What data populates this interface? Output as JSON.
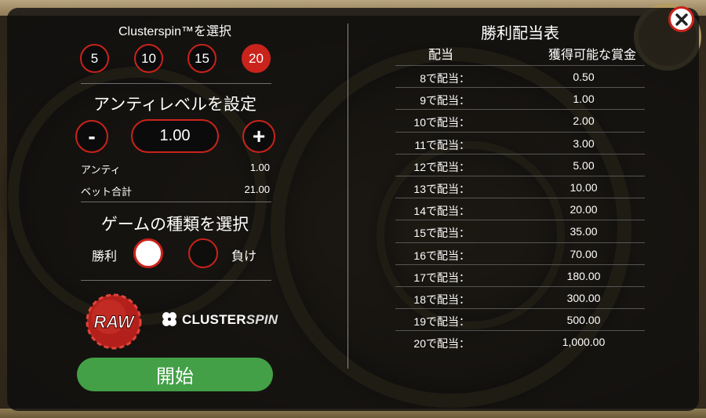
{
  "left": {
    "cluster_title": "Clusterspin™を選択",
    "cluster_options": [
      "5",
      "10",
      "15",
      "20"
    ],
    "cluster_selected": "20",
    "ante_title": "アンティレベルを設定",
    "minus_label": "-",
    "plus_label": "+",
    "ante_value": "1.00",
    "ante_label": "アンティ",
    "ante_amount": "1.00",
    "total_bet_label": "ベット合計",
    "total_bet_amount": "21.00",
    "game_type_title": "ゲームの種類を選択",
    "win_label": "勝利",
    "lose_label": "負け",
    "win_selected": true,
    "raw_logo_text": "RAW",
    "cs_logo_bold": "CLUSTER",
    "cs_logo_italic": "SPIN",
    "start_label": "開始"
  },
  "paytable": {
    "title": "勝利配当表",
    "col_payout": "配当",
    "col_prize": "獲得可能な賞金",
    "rows": [
      {
        "label": "8で配当：",
        "value": "0.50"
      },
      {
        "label": "9で配当：",
        "value": "1.00"
      },
      {
        "label": "10で配当：",
        "value": "2.00"
      },
      {
        "label": "11で配当：",
        "value": "3.00"
      },
      {
        "label": "12で配当：",
        "value": "5.00"
      },
      {
        "label": "13で配当：",
        "value": "10.00"
      },
      {
        "label": "14で配当：",
        "value": "20.00"
      },
      {
        "label": "15で配当：",
        "value": "35.00"
      },
      {
        "label": "16で配当：",
        "value": "70.00"
      },
      {
        "label": "17で配当：",
        "value": "180.00"
      },
      {
        "label": "18で配当：",
        "value": "300.00"
      },
      {
        "label": "19で配当：",
        "value": "500.00"
      },
      {
        "label": "20で配当：",
        "value": "1,000.00"
      }
    ]
  },
  "icons": {
    "close": "close-icon",
    "raw_logo": "raw-logo",
    "clover": "clover-icon"
  },
  "colors": {
    "accent_red": "#c9231c",
    "start_green": "#43a047",
    "overlay": "#0c0c0c"
  }
}
